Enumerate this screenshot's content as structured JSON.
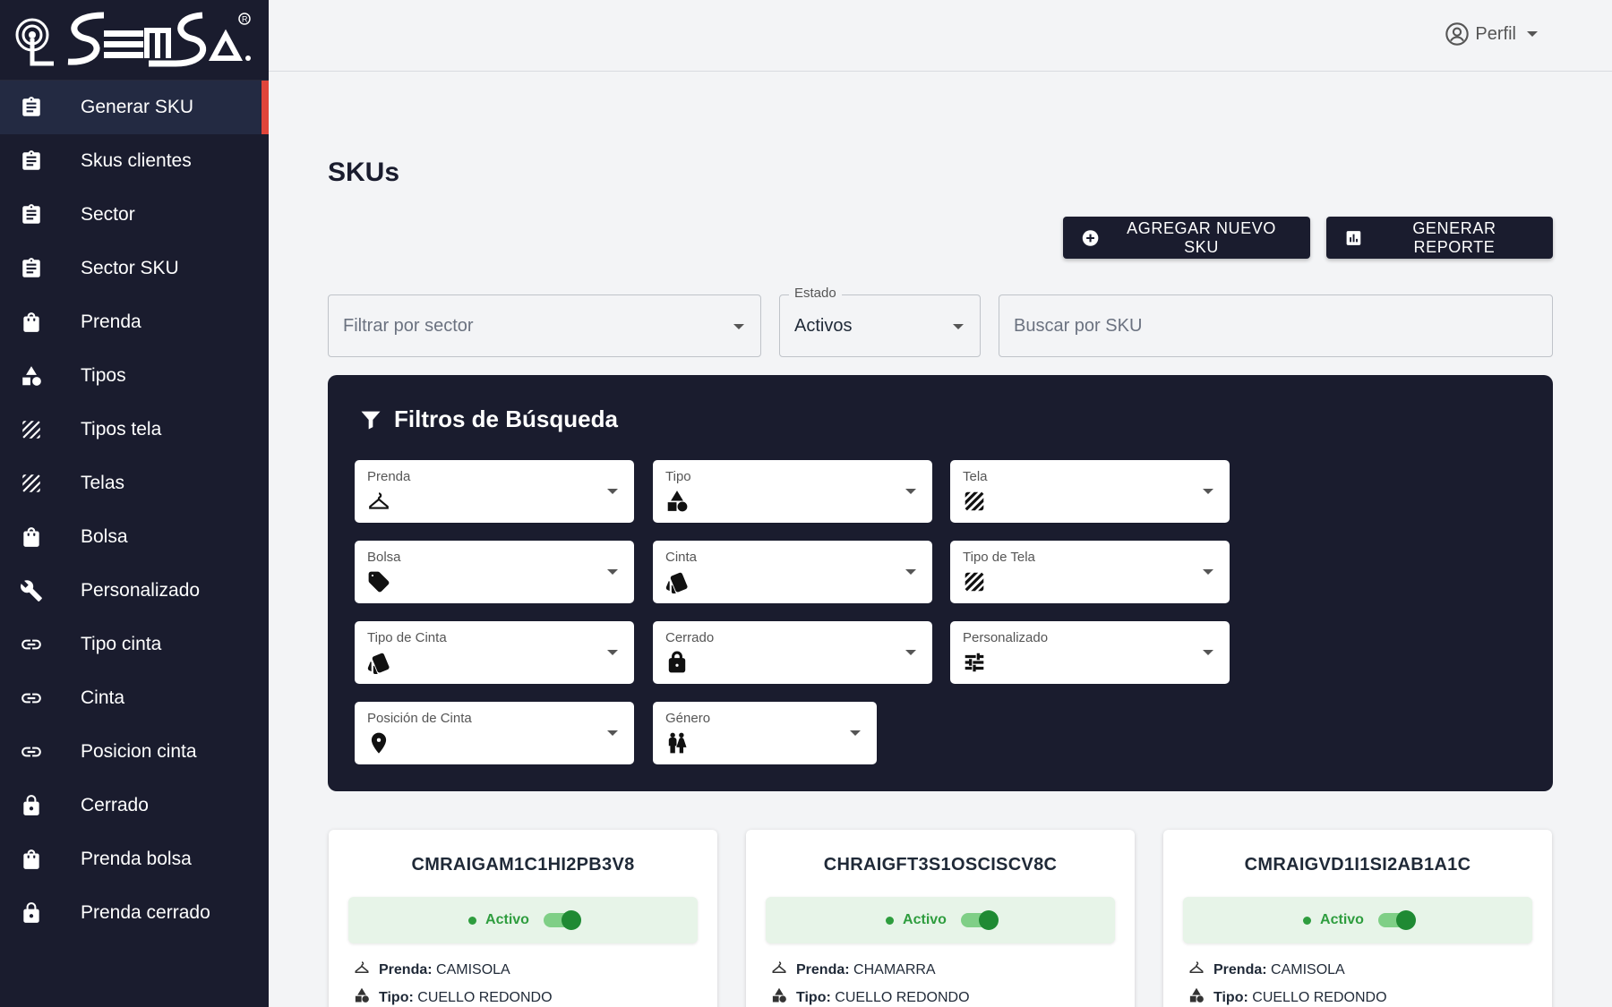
{
  "brand": {
    "logo_text": "SEMSA",
    "registered_mark": "R"
  },
  "sidebar": {
    "items": [
      {
        "label": "Generar SKU",
        "icon": "clipboard-icon"
      },
      {
        "label": "Skus clientes",
        "icon": "clipboard-icon"
      },
      {
        "label": "Sector",
        "icon": "clipboard-icon"
      },
      {
        "label": "Sector SKU",
        "icon": "clipboard-icon"
      },
      {
        "label": "Prenda",
        "icon": "shopping-bag-icon"
      },
      {
        "label": "Tipos",
        "icon": "shapes-icon"
      },
      {
        "label": "Tipos tela",
        "icon": "texture-icon"
      },
      {
        "label": "Telas",
        "icon": "texture-icon"
      },
      {
        "label": "Bolsa",
        "icon": "shopping-bag-icon"
      },
      {
        "label": "Personalizado",
        "icon": "wrench-icon"
      },
      {
        "label": "Tipo cinta",
        "icon": "link-icon"
      },
      {
        "label": "Cinta",
        "icon": "link-icon"
      },
      {
        "label": "Posicion cinta",
        "icon": "link-icon"
      },
      {
        "label": "Cerrado",
        "icon": "lock-icon"
      },
      {
        "label": "Prenda bolsa",
        "icon": "shopping-bag-icon"
      },
      {
        "label": "Prenda cerrado",
        "icon": "lock-icon"
      }
    ],
    "active_index": 0,
    "accent_color": "#e0453a"
  },
  "topbar": {
    "profile_label": "Perfil"
  },
  "main": {
    "title": "SKUs",
    "add_button_label": "AGREGAR NUEVO SKU",
    "report_button_label": "GENERAR REPORTE",
    "sector_filter_placeholder": "Filtrar por sector",
    "estado_label": "Estado",
    "estado_value": "Activos",
    "search_placeholder": "Buscar por SKU"
  },
  "filters": {
    "title": "Filtros de Búsqueda",
    "fields": [
      {
        "label": "Prenda",
        "icon": "hanger-icon"
      },
      {
        "label": "Tipo",
        "icon": "shapes-icon"
      },
      {
        "label": "Tela",
        "icon": "texture-icon"
      },
      {
        "label": "Bolsa",
        "icon": "tag-icon"
      },
      {
        "label": "Cinta",
        "icon": "style-icon"
      },
      {
        "label": "Tipo de Tela",
        "icon": "texture-icon"
      },
      {
        "label": "Tipo de Cinta",
        "icon": "style-icon"
      },
      {
        "label": "Cerrado",
        "icon": "lock-icon"
      },
      {
        "label": "Personalizado",
        "icon": "tune-icon"
      },
      {
        "label": "Posición de Cinta",
        "icon": "location-pin-icon"
      },
      {
        "label": "Género",
        "icon": "wc-icon"
      }
    ]
  },
  "cards": [
    {
      "sku": "CMRAIGAM1C1HI2PB3V8",
      "status": "Activo",
      "prenda_label": "Prenda:",
      "prenda": "CAMISOLA",
      "tipo_label": "Tipo:",
      "tipo": "CUELLO REDONDO"
    },
    {
      "sku": "CHRAIGFT3S1OSCISCV8C",
      "status": "Activo",
      "prenda_label": "Prenda:",
      "prenda": "CHAMARRA",
      "tipo_label": "Tipo:",
      "tipo": "CUELLO REDONDO"
    },
    {
      "sku": "CMRAIGVD1I1SI2AB1A1C",
      "status": "Activo",
      "prenda_label": "Prenda:",
      "prenda": "CAMISOLA",
      "tipo_label": "Tipo:",
      "tipo": "CUELLO REDONDO"
    }
  ],
  "colors": {
    "sidebar_bg": "#1a1c2e",
    "active_status": "#2e9d3e",
    "page_bg": "#f3f4f6"
  }
}
